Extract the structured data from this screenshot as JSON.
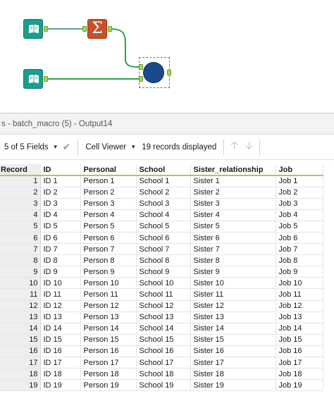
{
  "workflow": {
    "tools": [
      {
        "name": "input-data-tool-1",
        "icon": "book-icon"
      },
      {
        "name": "summarize-tool",
        "icon": "sigma-icon",
        "glyph": "Σ"
      },
      {
        "name": "input-data-tool-2",
        "icon": "book-icon"
      },
      {
        "name": "browse-tool",
        "icon": "browse-circle-icon"
      }
    ],
    "colors": {
      "input_tool": "#1b9e8f",
      "summarize_tool": "#c8502a",
      "browse_tool": "#1a4a8a",
      "connection": "#2ca24a",
      "anchor": "#a6d85a",
      "selection": "#3a7fd5"
    }
  },
  "results": {
    "title": "s - batch_macro (5) - Output14",
    "toolbar": {
      "fields_label": "5 of 5 Fields",
      "viewer_label": "Cell Viewer",
      "records_label": "19 records displayed"
    },
    "columns": [
      "Record",
      "ID",
      "Personal",
      "School",
      "Sister_relationship",
      "Job"
    ],
    "rows": [
      [
        "1",
        "ID 1",
        "Person 1",
        "School 1",
        "Sister 1",
        "Job 1"
      ],
      [
        "2",
        "ID 2",
        "Person 2",
        "School 2",
        "Sister 2",
        "Job 2"
      ],
      [
        "3",
        "ID 3",
        "Person 3",
        "School 3",
        "Sister 3",
        "Job 3"
      ],
      [
        "4",
        "ID 4",
        "Person 4",
        "School 4",
        "Sister 4",
        "Job 4"
      ],
      [
        "5",
        "ID 5",
        "Person 5",
        "School 5",
        "Sister 5",
        "Job 5"
      ],
      [
        "6",
        "ID 6",
        "Person 6",
        "School 6",
        "Sister 6",
        "Job 6"
      ],
      [
        "7",
        "ID 7",
        "Person 7",
        "School 7",
        "Sister 7",
        "Job 7"
      ],
      [
        "8",
        "ID 8",
        "Person 8",
        "School 8",
        "Sister 8",
        "Job 8"
      ],
      [
        "9",
        "ID 9",
        "Person 9",
        "School 9",
        "Sister 9",
        "Job 9"
      ],
      [
        "10",
        "ID 10",
        "Person 10",
        "School 10",
        "Sister 10",
        "Job 10"
      ],
      [
        "11",
        "ID 11",
        "Person 11",
        "School 11",
        "Sister 11",
        "Job 11"
      ],
      [
        "12",
        "ID 12",
        "Person 12",
        "School 12",
        "Sister 12",
        "Job 12"
      ],
      [
        "13",
        "ID 13",
        "Person 13",
        "School 13",
        "Sister 13",
        "Job 13"
      ],
      [
        "14",
        "ID 14",
        "Person 14",
        "School 14",
        "Sister 14",
        "Job 14"
      ],
      [
        "15",
        "ID 15",
        "Person 15",
        "School 15",
        "Sister 15",
        "Job 15"
      ],
      [
        "16",
        "ID 16",
        "Person 16",
        "School 16",
        "Sister 16",
        "Job 16"
      ],
      [
        "17",
        "ID 17",
        "Person 17",
        "School 17",
        "Sister 17",
        "Job 17"
      ],
      [
        "18",
        "ID 18",
        "Person 18",
        "School 18",
        "Sister 18",
        "Job 18"
      ],
      [
        "19",
        "ID 19",
        "Person 19",
        "School 19",
        "Sister 19",
        "Job 19"
      ]
    ]
  }
}
